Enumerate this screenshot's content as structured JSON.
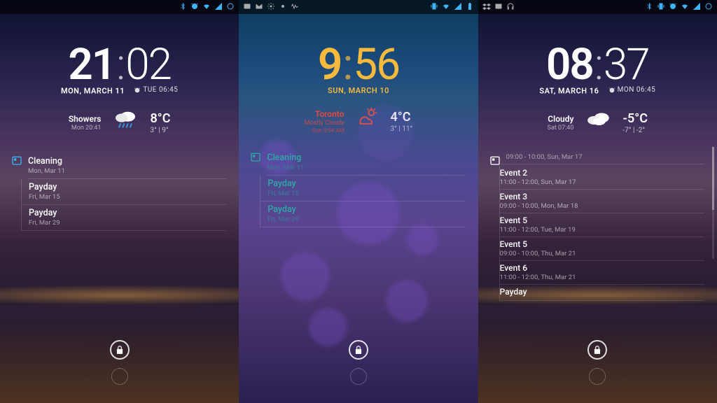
{
  "screens": [
    {
      "clock": {
        "hours": "21",
        "minutes": "02"
      },
      "date": "MON, MARCH 11",
      "alarm": "TUE 06:45",
      "weather": {
        "condition": "Showers",
        "condition_sub": "Mon 20:41",
        "temp": "8°C",
        "range": "3° | 9°",
        "icon": "rain"
      },
      "events": [
        {
          "title": "Cleaning",
          "sub": "Mon, Mar 11"
        },
        {
          "title": "Payday",
          "sub": "Fri, Mar 15"
        },
        {
          "title": "Payday",
          "sub": "Fri, Mar 29"
        }
      ]
    },
    {
      "clock": {
        "hours": "9",
        "minutes": "56"
      },
      "date": "SUN, MARCH 10",
      "weather": {
        "location": "Toronto",
        "condition": "Mostly Cloudy",
        "condition_sub": "Sun 9:54 AM",
        "temp": "4°C",
        "range": "3° | 11°",
        "icon": "partly"
      },
      "events": [
        {
          "title": "Cleaning",
          "sub": "Mon, Mar 11"
        },
        {
          "title": "Payday",
          "sub": "Fri, Mar 15"
        },
        {
          "title": "Payday",
          "sub": "Fri, Mar 29"
        }
      ]
    },
    {
      "clock": {
        "hours": "08",
        "minutes": "37"
      },
      "date": "SAT, MARCH 16",
      "alarm": "MON 06:45",
      "weather": {
        "condition": "Cloudy",
        "condition_sub": "Sat 07:40",
        "temp": "-5°C",
        "range": "-7° | -2°",
        "icon": "cloudy"
      },
      "extra_top": "09:00 - 10:00, Sun, Mar 17",
      "events": [
        {
          "title": "Event 2",
          "sub": "11:00 - 12:00, Sun, Mar 17"
        },
        {
          "title": "Event 3",
          "sub": "09:00 - 10:00, Mon, Mar 18"
        },
        {
          "title": "Event 5",
          "sub": "11:00 - 12:00, Tue, Mar 19"
        },
        {
          "title": "Event 5",
          "sub": "09:00 - 10:00, Thu, Mar 21"
        },
        {
          "title": "Event 6",
          "sub": "11:00 - 12:00, Thu, Mar 21"
        },
        {
          "title": "Payday",
          "sub": ""
        }
      ]
    }
  ]
}
